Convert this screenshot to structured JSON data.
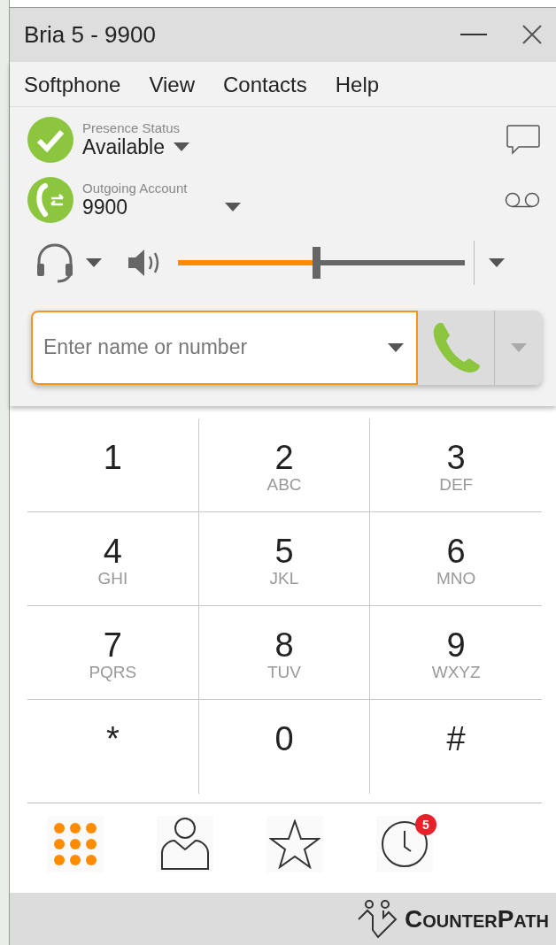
{
  "window": {
    "title": "Bria 5 - 9900"
  },
  "menu": [
    "Softphone",
    "View",
    "Contacts",
    "Help"
  ],
  "presence": {
    "label": "Presence Status",
    "value": "Available"
  },
  "account": {
    "label": "Outgoing Account",
    "value": "9900"
  },
  "volume": {
    "level": 0.48
  },
  "dial_field": {
    "placeholder": "Enter name or number"
  },
  "keypad": [
    {
      "digit": "1"
    },
    {
      "digit": "2",
      "letters": "ABC"
    },
    {
      "digit": "3",
      "letters": "DEF"
    },
    {
      "digit": "4",
      "letters": "GHI"
    },
    {
      "digit": "5",
      "letters": "JKL"
    },
    {
      "digit": "6",
      "letters": "MNO"
    },
    {
      "digit": "7",
      "letters": "PQRS"
    },
    {
      "digit": "8",
      "letters": "TUV"
    },
    {
      "digit": "9",
      "letters": "WXYZ"
    },
    {
      "digit": "*"
    },
    {
      "digit": "0"
    },
    {
      "digit": "#"
    }
  ],
  "tabs": [
    {
      "kind": "dialpad",
      "selected": true
    },
    {
      "kind": "contacts",
      "selected": false
    },
    {
      "kind": "favorites",
      "selected": false
    },
    {
      "kind": "history",
      "selected": false,
      "badge": "5"
    }
  ],
  "footer": {
    "brand": "CounterPath"
  }
}
